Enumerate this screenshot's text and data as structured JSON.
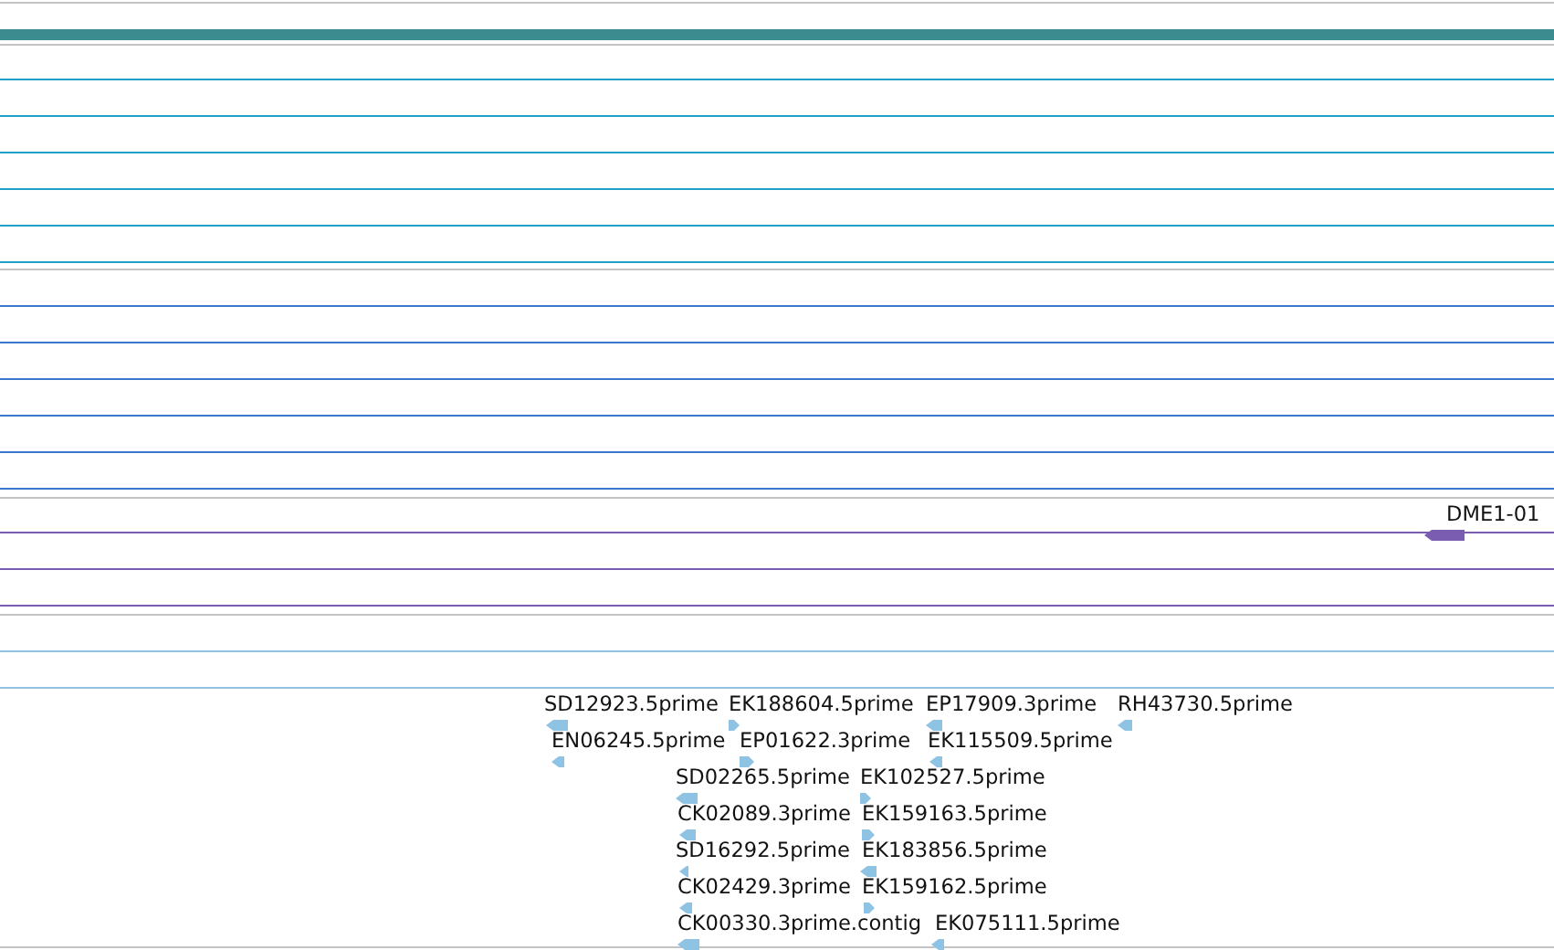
{
  "tracks": [
    {
      "kind": "bar",
      "color": "#3a8c8f"
    },
    {
      "kind": "rows",
      "color": "#1ea0c8"
    },
    {
      "kind": "rows",
      "color": "#3a78d0"
    },
    {
      "kind": "rows",
      "color": "#7a5cb0",
      "features": [
        {
          "label": "DME1-01",
          "kind": "reverse"
        }
      ]
    },
    {
      "kind": "rows",
      "color": "#8fc3e3",
      "features": [
        {
          "label": "SD12923.5prime",
          "kind": "reverse"
        },
        {
          "label": "EK188604.5prime",
          "kind": "forward"
        },
        {
          "label": "EP17909.3prime",
          "kind": "reverse"
        },
        {
          "label": "RH43730.5prime",
          "kind": "reverse"
        },
        {
          "label": "EN06245.5prime",
          "kind": "reverse"
        },
        {
          "label": "EP01622.3prime",
          "kind": "forward"
        },
        {
          "label": "EK115509.5prime",
          "kind": "reverse"
        },
        {
          "label": "SD02265.5prime",
          "kind": "reverse"
        },
        {
          "label": "EK102527.5prime",
          "kind": "forward"
        },
        {
          "label": "CK02089.3prime",
          "kind": "reverse"
        },
        {
          "label": "EK159163.5prime",
          "kind": "forward"
        },
        {
          "label": "SD16292.5prime",
          "kind": "reverse"
        },
        {
          "label": "EK183856.5prime",
          "kind": "reverse"
        },
        {
          "label": "CK02429.3prime",
          "kind": "reverse"
        },
        {
          "label": "EK159162.5prime",
          "kind": "forward"
        },
        {
          "label": "CK00330.3prime.contig",
          "kind": "reverse"
        },
        {
          "label": "EK075111.5prime",
          "kind": "reverse"
        }
      ]
    }
  ]
}
